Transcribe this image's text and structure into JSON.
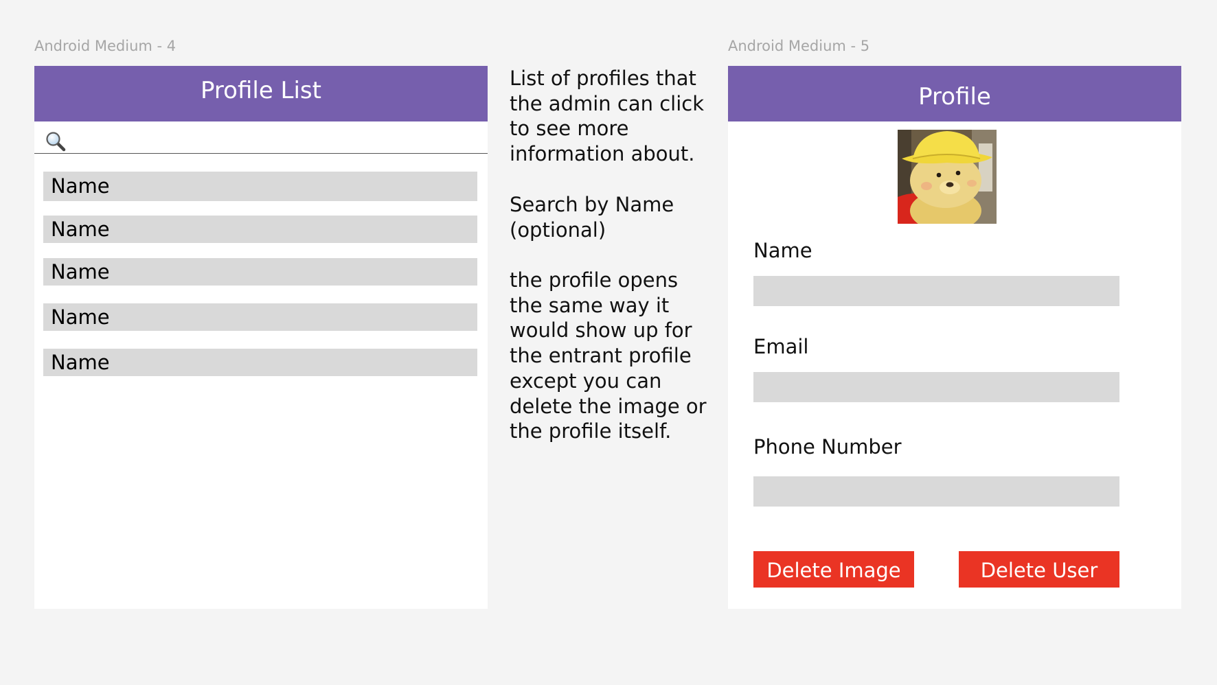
{
  "frames": {
    "list_label": "Android Medium - 4",
    "profile_label": "Android Medium - 5"
  },
  "profile_list": {
    "title": "Profile List",
    "search": {
      "value": "",
      "placeholder": ""
    },
    "items": [
      {
        "label": "Name"
      },
      {
        "label": "Name"
      },
      {
        "label": "Name"
      },
      {
        "label": "Name"
      },
      {
        "label": "Name"
      }
    ]
  },
  "notes": {
    "paragraph_1": "List of profiles that the admin can click to see more information about.",
    "paragraph_2": "Search by Name (optional)",
    "paragraph_3": "the profile opens the same way it would show up for the entrant profile except you can delete the image or the profile itself."
  },
  "profile": {
    "title": "Profile",
    "avatar": "teddy-bear-photo",
    "fields": {
      "name_label": "Name",
      "name_value": "",
      "email_label": "Email",
      "email_value": "",
      "phone_label": "Phone Number",
      "phone_value": ""
    },
    "delete_image_label": "Delete Image",
    "delete_user_label": "Delete User"
  },
  "colors": {
    "appbar": "#765fad",
    "delete_button": "#ea3424",
    "list_item": "#d9d9d9",
    "canvas": "#f4f4f4"
  },
  "icons": [
    "search-icon"
  ]
}
